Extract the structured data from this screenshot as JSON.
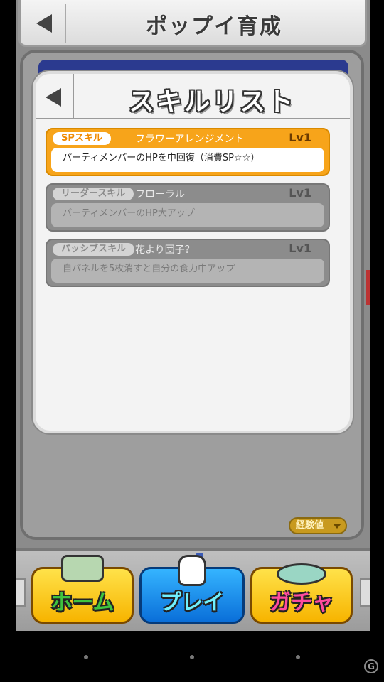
{
  "background": {
    "title": "ポップイ育成",
    "exp_button": "経験値"
  },
  "dialog": {
    "title": "スキルリスト"
  },
  "skills": [
    {
      "badge": "SPスキル",
      "name": "フラワーアレンジメント",
      "level": "Lv1",
      "description": "パーティメンバーのHPを中回復（消費SP☆☆）",
      "state": "active"
    },
    {
      "badge": "リーダースキル",
      "name": "フローラル",
      "level": "Lv1",
      "description": "パーティメンバーのHP大アップ",
      "state": "inactive"
    },
    {
      "badge": "パッシブスキル",
      "name": "花より団子？",
      "level": "Lv1",
      "description": "自パネルを5枚消すと自分の食力中アップ",
      "state": "inactive"
    }
  ],
  "nav": {
    "home": "ホーム",
    "play": "プレイ",
    "gacha": "ガチャ"
  },
  "watermark": "G"
}
